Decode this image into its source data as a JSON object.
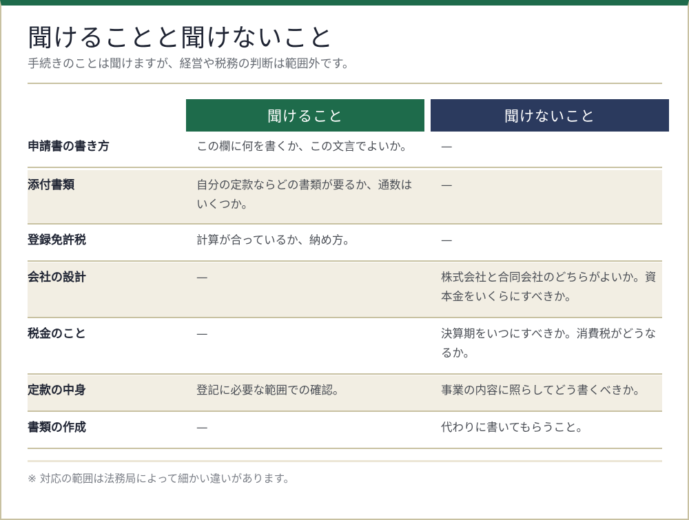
{
  "title": "聞けることと聞けないこと",
  "subtitle": "手続きのことは聞けますが、経営や税務の判断は範囲外です。",
  "columns": {
    "can": "聞けること",
    "cannot": "聞けないこと"
  },
  "rows": [
    {
      "label": "申請書の書き方",
      "can": "この欄に何を書くか、この文言でよいか。",
      "cannot": "—"
    },
    {
      "label": "添付書類",
      "can": "自分の定款ならどの書類が要るか、通数はいくつか。",
      "cannot": "—"
    },
    {
      "label": "登録免許税",
      "can": "計算が合っているか、納め方。",
      "cannot": "—"
    },
    {
      "label": "会社の設計",
      "can": "—",
      "cannot": "株式会社と合同会社のどちらがよいか。資本金をいくらにすべきか。"
    },
    {
      "label": "税金のこと",
      "can": "—",
      "cannot": "決算期をいつにすべきか。消費税がどうなるか。"
    },
    {
      "label": "定款の中身",
      "can": "登記に必要な範囲での確認。",
      "cannot": "事業の内容に照らしてどう書くべきか。"
    },
    {
      "label": "書類の作成",
      "can": "—",
      "cannot": "代わりに書いてもらうこと。"
    }
  ],
  "footnote": "※ 対応の範囲は法務局によって細かい違いがあります。",
  "colors": {
    "accent_green": "#1e6b4b",
    "accent_navy": "#2b3a5e",
    "rule": "#c8c1a1",
    "alt_row": "#f2eee3"
  }
}
